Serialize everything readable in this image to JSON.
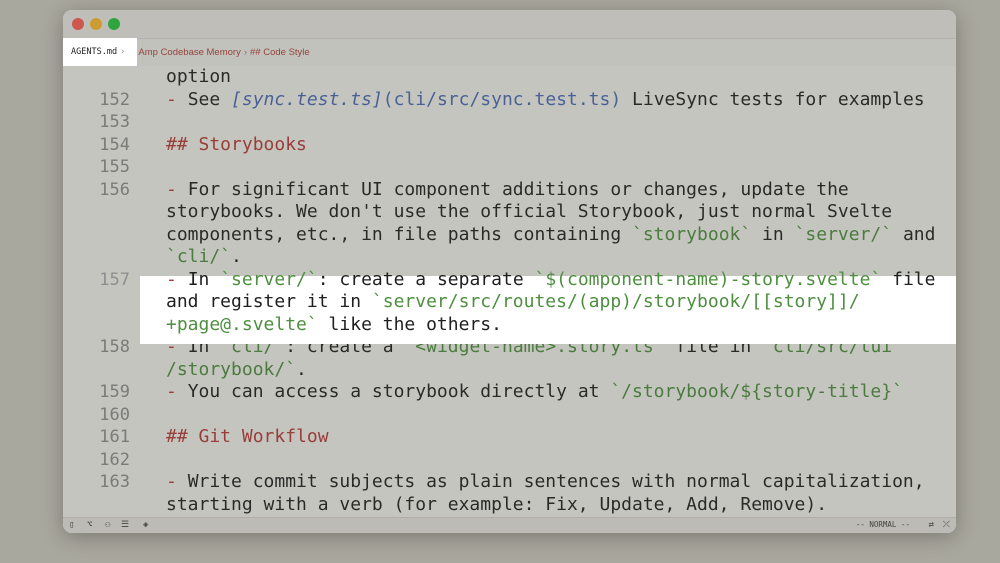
{
  "breadcrumb": {
    "file": "AGENTS.md",
    "items": [
      "# Amp Codebase Memory",
      "## Code Style"
    ]
  },
  "editor": {
    "lines": [
      {
        "num": "",
        "segments": [
          {
            "text": "option",
            "cls": ""
          }
        ]
      },
      {
        "num": "152",
        "segments": [
          {
            "text": "- ",
            "cls": "dash"
          },
          {
            "text": "See ",
            "cls": ""
          },
          {
            "text": "[sync.test.ts]",
            "cls": "link"
          },
          {
            "text": "(cli/src/sync.test.ts)",
            "cls": "url"
          },
          {
            "text": " LiveSync tests for examples",
            "cls": ""
          }
        ]
      },
      {
        "num": "153",
        "segments": []
      },
      {
        "num": "154",
        "segments": [
          {
            "text": "## Storybooks",
            "cls": "head"
          }
        ]
      },
      {
        "num": "155",
        "segments": []
      },
      {
        "num": "156",
        "segments": [
          {
            "text": "- ",
            "cls": "dash"
          },
          {
            "text": "For significant UI component additions or changes, update the",
            "cls": ""
          }
        ]
      },
      {
        "num": "",
        "segments": [
          {
            "text": "storybooks. We don't use the official Storybook, just normal Svelte",
            "cls": ""
          }
        ]
      },
      {
        "num": "",
        "segments": [
          {
            "text": "components, etc., in file paths containing ",
            "cls": ""
          },
          {
            "text": "`storybook`",
            "cls": "code"
          },
          {
            "text": " in ",
            "cls": ""
          },
          {
            "text": "`server/`",
            "cls": "code"
          },
          {
            "text": " and",
            "cls": ""
          }
        ]
      },
      {
        "num": "",
        "segments": [
          {
            "text": "`cli/`",
            "cls": "code"
          },
          {
            "text": ".",
            "cls": ""
          }
        ]
      },
      {
        "num": "157",
        "segments": [
          {
            "text": "- ",
            "cls": "dash"
          },
          {
            "text": "In ",
            "cls": ""
          },
          {
            "text": "`server/`",
            "cls": "code"
          },
          {
            "text": ": create a separate ",
            "cls": ""
          },
          {
            "text": "`$(component-name)-story.svelte`",
            "cls": "code"
          },
          {
            "text": " file",
            "cls": ""
          }
        ]
      },
      {
        "num": "",
        "segments": [
          {
            "text": "and register it in ",
            "cls": ""
          },
          {
            "text": "`server/src/routes/(app)/storybook/[[story]]/",
            "cls": "code"
          }
        ]
      },
      {
        "num": "",
        "segments": [
          {
            "text": "+page@.svelte`",
            "cls": "code"
          },
          {
            "text": " like the others.",
            "cls": ""
          }
        ]
      },
      {
        "num": "158",
        "segments": [
          {
            "text": "- ",
            "cls": "dash"
          },
          {
            "text": "In ",
            "cls": ""
          },
          {
            "text": "`cli/`",
            "cls": "code"
          },
          {
            "text": ": create a ",
            "cls": ""
          },
          {
            "text": "`<widget-name>.story.ts`",
            "cls": "code"
          },
          {
            "text": " file in ",
            "cls": ""
          },
          {
            "text": "`cli/src/tui",
            "cls": "code"
          }
        ]
      },
      {
        "num": "",
        "segments": [
          {
            "text": "/storybook/`",
            "cls": "code"
          },
          {
            "text": ".",
            "cls": ""
          }
        ]
      },
      {
        "num": "159",
        "segments": [
          {
            "text": "- ",
            "cls": "dash"
          },
          {
            "text": "You can access a storybook directly at ",
            "cls": ""
          },
          {
            "text": "`/storybook/${story-title}`",
            "cls": "code"
          }
        ]
      },
      {
        "num": "160",
        "segments": []
      },
      {
        "num": "161",
        "segments": [
          {
            "text": "## Git Workflow",
            "cls": "head"
          }
        ]
      },
      {
        "num": "162",
        "segments": []
      },
      {
        "num": "163",
        "segments": [
          {
            "text": "- ",
            "cls": "dash"
          },
          {
            "text": "Write commit subjects as plain sentences with normal capitalization,",
            "cls": ""
          }
        ]
      },
      {
        "num": "",
        "segments": [
          {
            "text": "starting with a verb (for example: Fix, Update, Add, Remove).",
            "cls": ""
          }
        ]
      }
    ]
  },
  "statusbar": {
    "mode": "-- NORMAL --"
  },
  "icons": [
    "sidebar-toggle-icon",
    "git-branch-icon",
    "users-icon",
    "list-icon",
    "diamond-icon",
    "translate-icon",
    "no-wrap-icon"
  ]
}
